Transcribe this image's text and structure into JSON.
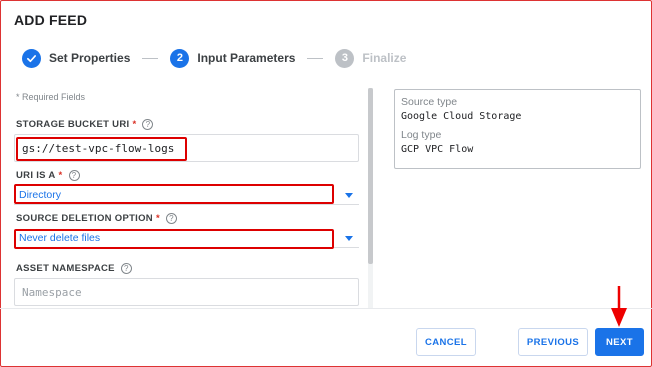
{
  "dialog": {
    "title": "ADD FEED"
  },
  "stepper": {
    "steps": [
      {
        "number": "",
        "label": "Set Properties",
        "state": "done"
      },
      {
        "number": "2",
        "label": "Input Parameters",
        "state": "active"
      },
      {
        "number": "3",
        "label": "Finalize",
        "state": "todo"
      }
    ]
  },
  "form": {
    "required_note": "* Required Fields",
    "storage_bucket": {
      "label": "STORAGE BUCKET URI",
      "star": "*",
      "value": "gs://test-vpc-flow-logs"
    },
    "uri_is_a": {
      "label": "URI IS A",
      "star": "*",
      "value": "Directory"
    },
    "source_deletion": {
      "label": "SOURCE DELETION OPTION",
      "star": "*",
      "value": "Never delete files"
    },
    "asset_namespace": {
      "label": "ASSET NAMESPACE",
      "placeholder": "Namespace"
    },
    "help_glyph": "?"
  },
  "info_panel": {
    "source_type_label": "Source type",
    "source_type_value": "Google Cloud Storage",
    "log_type_label": "Log type",
    "log_type_value": "GCP VPC Flow"
  },
  "buttons": {
    "cancel": "CANCEL",
    "previous": "PREVIOUS",
    "next": "NEXT"
  },
  "colors": {
    "accent": "#1a73e8",
    "highlight": "#dd0000",
    "required": "#d93025"
  },
  "icons": {
    "done_step": "check-icon",
    "help": "help-circle-icon",
    "dropdown": "caret-down-icon",
    "annotation": "red-arrow-icon"
  }
}
